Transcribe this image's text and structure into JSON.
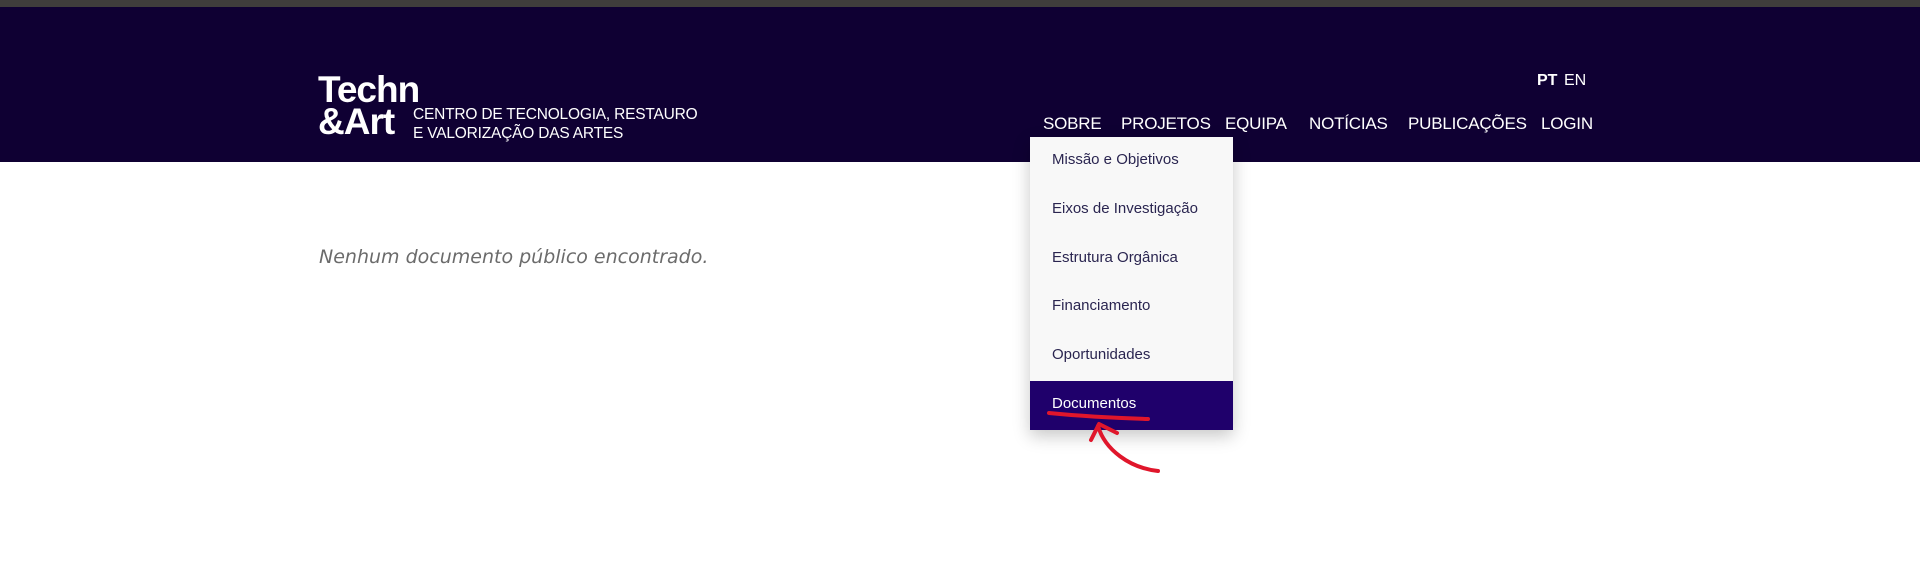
{
  "logo": {
    "line1": "Techn",
    "line2": "&Art",
    "subtitle_line1": "CENTRO DE TECNOLOGIA, RESTAURO",
    "subtitle_line2": "E VALORIZAÇÃO DAS ARTES"
  },
  "languages": {
    "pt": "PT",
    "en": "EN",
    "active": "PT"
  },
  "nav": {
    "sobre": "SOBRE",
    "projetos": "PROJETOS",
    "equipa": "EQUIPA",
    "noticias": "NOTÍCIAS",
    "publicacoes": "PUBLICAÇÕES",
    "login": "LOGIN"
  },
  "dropdown": {
    "items": [
      "Missão e Objetivos",
      "Eixos de Investigação",
      "Estrutura Orgânica",
      "Financiamento",
      "Oportunidades",
      "Documentos"
    ],
    "active": "Documentos"
  },
  "main": {
    "empty_message": "Nenhum documento público encontrado."
  },
  "colors": {
    "header_bg": "#0f0033",
    "top_strip": "#3f3d3c",
    "dropdown_active_bg": "#1f006b",
    "annotation": "#e0162b"
  }
}
